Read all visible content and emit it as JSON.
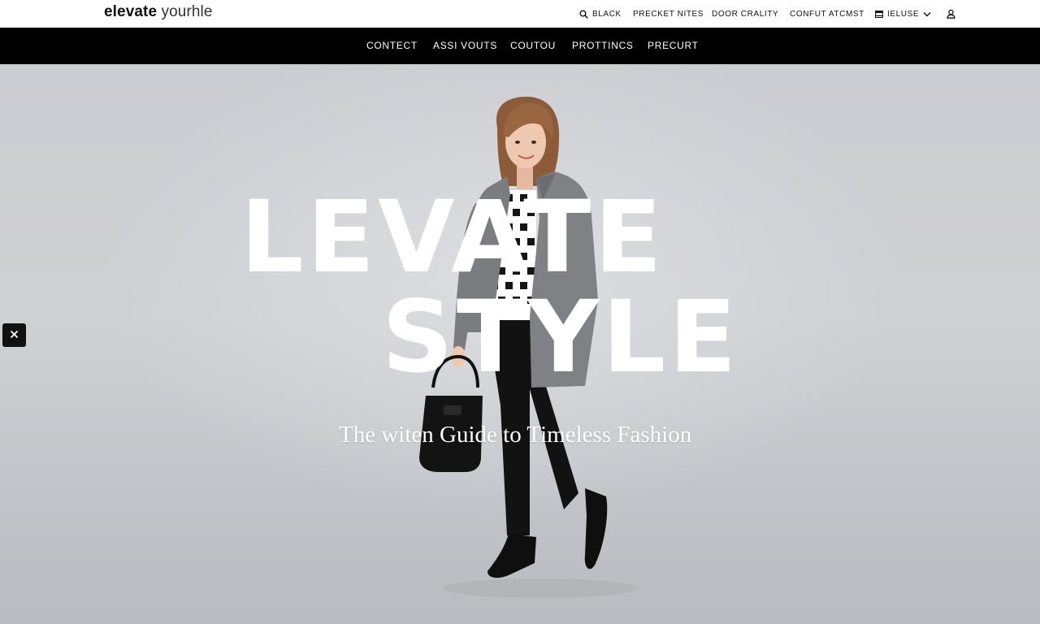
{
  "header": {
    "logo_bold": "elevate",
    "logo_light": "yourhle",
    "utility": {
      "search_label": "BLACK",
      "precket_label": "PRECKET NITES",
      "door_label": "DOOR CRALITY",
      "confut_label": "CONFUT ATCMST",
      "lang_label": "IELUSE"
    }
  },
  "nav": {
    "items": [
      "CONTECT",
      "ASSI VOUTS",
      "COUTOU",
      "PROTTINCS",
      "PRECURT"
    ]
  },
  "hero": {
    "line1": "LEVATE",
    "line2": "STYLE",
    "subtitle": "The witen Guide to Timeless Fashion"
  },
  "icons": {
    "search": "search-icon",
    "lang": "flag-icon",
    "chevron": "chevron-down-icon",
    "user": "user-icon",
    "close": "close-icon"
  },
  "colors": {
    "nav_bg": "#000000",
    "hero_bg": "#cfd0d4",
    "headline": "#ffffff",
    "blazer": "#7c7d80",
    "pants": "#111111"
  }
}
